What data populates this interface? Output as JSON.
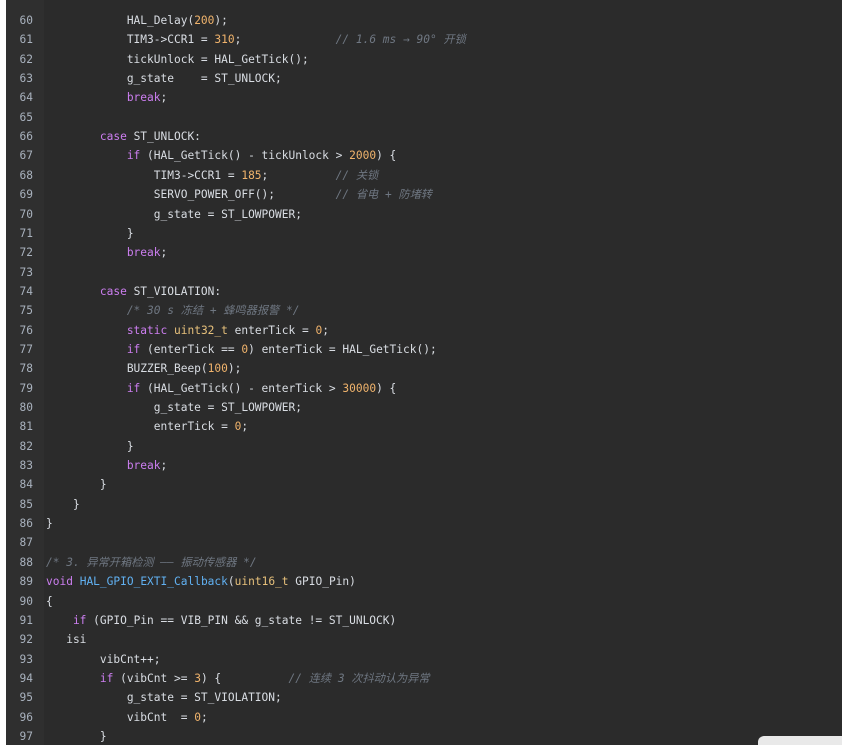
{
  "editor": {
    "lines": [
      {
        "n": "60",
        "segs": [
          {
            "c": "d",
            "t": "            HAL_Delay("
          },
          {
            "c": "num",
            "t": "200"
          },
          {
            "c": "d",
            "t": ");"
          }
        ]
      },
      {
        "n": "61",
        "segs": [
          {
            "c": "d",
            "t": "            TIM3->CCR1 = "
          },
          {
            "c": "num",
            "t": "310"
          },
          {
            "c": "d",
            "t": ";              "
          },
          {
            "c": "cmt",
            "t": "// 1.6 ms → 90° 开锁"
          }
        ]
      },
      {
        "n": "62",
        "segs": [
          {
            "c": "d",
            "t": "            tickUnlock = HAL_GetTick();"
          }
        ]
      },
      {
        "n": "63",
        "segs": [
          {
            "c": "d",
            "t": "            g_state    = ST_UNLOCK;"
          }
        ]
      },
      {
        "n": "64",
        "segs": [
          {
            "c": "kw",
            "t": "            break"
          },
          {
            "c": "d",
            "t": ";"
          }
        ]
      },
      {
        "n": "65",
        "segs": []
      },
      {
        "n": "66",
        "segs": [
          {
            "c": "kw",
            "t": "        case"
          },
          {
            "c": "d",
            "t": " ST_UNLOCK:"
          }
        ]
      },
      {
        "n": "67",
        "segs": [
          {
            "c": "kw",
            "t": "            if"
          },
          {
            "c": "d",
            "t": " (HAL_GetTick() - tickUnlock > "
          },
          {
            "c": "num",
            "t": "2000"
          },
          {
            "c": "d",
            "t": ") {"
          }
        ]
      },
      {
        "n": "68",
        "segs": [
          {
            "c": "d",
            "t": "                TIM3->CCR1 = "
          },
          {
            "c": "num",
            "t": "185"
          },
          {
            "c": "d",
            "t": ";          "
          },
          {
            "c": "cmt",
            "t": "// 关锁"
          }
        ]
      },
      {
        "n": "69",
        "segs": [
          {
            "c": "d",
            "t": "                SERVO_POWER_OFF();         "
          },
          {
            "c": "cmt",
            "t": "// 省电 + 防堵转"
          }
        ]
      },
      {
        "n": "70",
        "segs": [
          {
            "c": "d",
            "t": "                g_state = ST_LOWPOWER;"
          }
        ]
      },
      {
        "n": "71",
        "segs": [
          {
            "c": "d",
            "t": "            }"
          }
        ]
      },
      {
        "n": "72",
        "segs": [
          {
            "c": "kw",
            "t": "            break"
          },
          {
            "c": "d",
            "t": ";"
          }
        ]
      },
      {
        "n": "73",
        "segs": []
      },
      {
        "n": "74",
        "segs": [
          {
            "c": "kw",
            "t": "        case"
          },
          {
            "c": "d",
            "t": " ST_VIOLATION:"
          }
        ]
      },
      {
        "n": "75",
        "segs": [
          {
            "c": "cmt",
            "t": "            /* 30 s 冻结 + 蜂鸣器报警 */"
          }
        ]
      },
      {
        "n": "76",
        "segs": [
          {
            "c": "kw",
            "t": "            static"
          },
          {
            "c": "d",
            "t": " "
          },
          {
            "c": "ty",
            "t": "uint32_t"
          },
          {
            "c": "d",
            "t": " enterTick = "
          },
          {
            "c": "num",
            "t": "0"
          },
          {
            "c": "d",
            "t": ";"
          }
        ]
      },
      {
        "n": "77",
        "segs": [
          {
            "c": "kw",
            "t": "            if"
          },
          {
            "c": "d",
            "t": " (enterTick == "
          },
          {
            "c": "num",
            "t": "0"
          },
          {
            "c": "d",
            "t": ") enterTick = HAL_GetTick();"
          }
        ]
      },
      {
        "n": "78",
        "segs": [
          {
            "c": "d",
            "t": "            BUZZER_Beep("
          },
          {
            "c": "num",
            "t": "100"
          },
          {
            "c": "d",
            "t": ");"
          }
        ]
      },
      {
        "n": "79",
        "segs": [
          {
            "c": "kw",
            "t": "            if"
          },
          {
            "c": "d",
            "t": " (HAL_GetTick() - enterTick > "
          },
          {
            "c": "num",
            "t": "30000"
          },
          {
            "c": "d",
            "t": ") {"
          }
        ]
      },
      {
        "n": "80",
        "segs": [
          {
            "c": "d",
            "t": "                g_state = ST_LOWPOWER;"
          }
        ]
      },
      {
        "n": "81",
        "segs": [
          {
            "c": "d",
            "t": "                enterTick = "
          },
          {
            "c": "num",
            "t": "0"
          },
          {
            "c": "d",
            "t": ";"
          }
        ]
      },
      {
        "n": "82",
        "segs": [
          {
            "c": "d",
            "t": "            }"
          }
        ]
      },
      {
        "n": "83",
        "segs": [
          {
            "c": "kw",
            "t": "            break"
          },
          {
            "c": "d",
            "t": ";"
          }
        ]
      },
      {
        "n": "84",
        "segs": [
          {
            "c": "d",
            "t": "        }"
          }
        ]
      },
      {
        "n": "85",
        "segs": [
          {
            "c": "d",
            "t": "    }"
          }
        ]
      },
      {
        "n": "86",
        "segs": [
          {
            "c": "d",
            "t": "}"
          }
        ]
      },
      {
        "n": "87",
        "segs": []
      },
      {
        "n": "88",
        "segs": [
          {
            "c": "cmt",
            "t": "/* 3. 异常开箱检测 —— 振动传感器 */"
          }
        ]
      },
      {
        "n": "89",
        "segs": [
          {
            "c": "kw",
            "t": "void"
          },
          {
            "c": "d",
            "t": " "
          },
          {
            "c": "fn",
            "t": "HAL_GPIO_EXTI_Callback"
          },
          {
            "c": "d",
            "t": "("
          },
          {
            "c": "ty",
            "t": "uint16_t"
          },
          {
            "c": "d",
            "t": " GPIO_Pin)"
          }
        ]
      },
      {
        "n": "90",
        "segs": [
          {
            "c": "d",
            "t": "{"
          }
        ]
      },
      {
        "n": "91",
        "segs": [
          {
            "c": "kw",
            "t": "    if"
          },
          {
            "c": "d",
            "t": " (GPIO_Pin == VIB_PIN && g_state != ST_UNLOCK)"
          }
        ]
      },
      {
        "n": "92",
        "segs": [
          {
            "c": "d",
            "t": "   isi"
          }
        ]
      },
      {
        "n": "93",
        "segs": [
          {
            "c": "d",
            "t": "        vibCnt++;"
          }
        ]
      },
      {
        "n": "94",
        "segs": [
          {
            "c": "kw",
            "t": "        if"
          },
          {
            "c": "d",
            "t": " (vibCnt >= "
          },
          {
            "c": "num",
            "t": "3"
          },
          {
            "c": "d",
            "t": ") {          "
          },
          {
            "c": "cmt",
            "t": "// 连续 3 次抖动认为异常"
          }
        ]
      },
      {
        "n": "95",
        "segs": [
          {
            "c": "d",
            "t": "            g_state = ST_VIOLATION;"
          }
        ]
      },
      {
        "n": "96",
        "segs": [
          {
            "c": "d",
            "t": "            vibCnt  = "
          },
          {
            "c": "num",
            "t": "0"
          },
          {
            "c": "d",
            "t": ";"
          }
        ]
      },
      {
        "n": "97",
        "segs": [
          {
            "c": "d",
            "t": "        }"
          }
        ]
      }
    ]
  }
}
